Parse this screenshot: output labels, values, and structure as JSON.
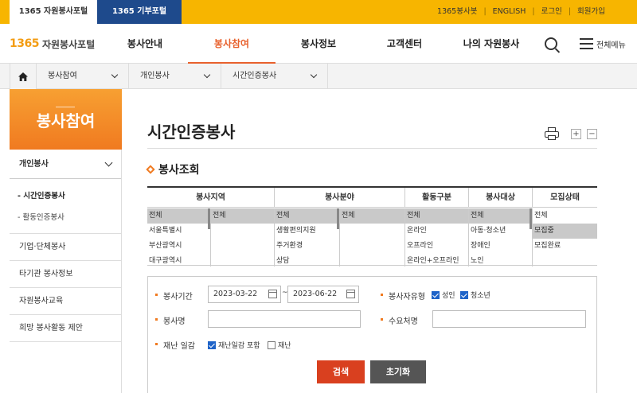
{
  "topbar": {
    "portal_tab": "1365 자원봉사포털",
    "donation_tab": "1365 기부포털",
    "links": [
      "1365봉사봇",
      "ENGLISH",
      "로그인",
      "회원가입"
    ]
  },
  "header": {
    "logo_num": "1365",
    "logo_text": "자원봉사포털",
    "nav": [
      "봉사안내",
      "봉사참여",
      "봉사정보",
      "고객센터",
      "나의 자원봉사"
    ],
    "menu_label": "전체메뉴"
  },
  "breadcrumb": [
    "봉사참여",
    "개인봉사",
    "시간인증봉사"
  ],
  "sidebar": {
    "title": "봉사참여",
    "section": "개인봉사",
    "subs": [
      "- 시간인증봉사",
      "- 활동인증봉사"
    ],
    "items": [
      "기업·단체봉사",
      "타기관 봉사정보",
      "자원봉사교육",
      "희망 봉사활동 제안"
    ]
  },
  "content": {
    "title": "시간인증봉사",
    "zoom_in": "+",
    "zoom_out": "−",
    "section_title": "봉사조회"
  },
  "filter": {
    "headers": [
      "봉사지역",
      "봉사분야",
      "활동구분",
      "봉사대상",
      "모집상태"
    ],
    "region1": [
      "전체",
      "서울특별시",
      "부산광역시",
      "대구광역시"
    ],
    "region2": [
      "전체"
    ],
    "field1": [
      "전체",
      "생활편의지원",
      "주거환경",
      "상담"
    ],
    "field2": [
      "전체"
    ],
    "activity": [
      "전체",
      "온라인",
      "오프라인",
      "온라인+오프라인"
    ],
    "target": [
      "전체",
      "아동·청소년",
      "장애인",
      "노인"
    ],
    "status": [
      "전체",
      "모집중",
      "모집완료"
    ]
  },
  "form": {
    "period_label": "봉사기간",
    "start_date": "2023-03-22",
    "tilde": "~",
    "end_date": "2023-06-22",
    "type_label": "봉사자유형",
    "type_adult": "성인",
    "type_youth": "청소년",
    "name_label": "봉사명",
    "name_value": "",
    "demand_label": "수요처명",
    "demand_value": "",
    "disaster_label": "재난 일감",
    "disaster_include": "재난일감 포함",
    "disaster_only": "재난",
    "search_btn": "검색",
    "reset_btn": "초기화"
  },
  "colors": {
    "accent": "#f07a20",
    "topbar": "#f7b500",
    "navy": "#1e4a8c"
  }
}
